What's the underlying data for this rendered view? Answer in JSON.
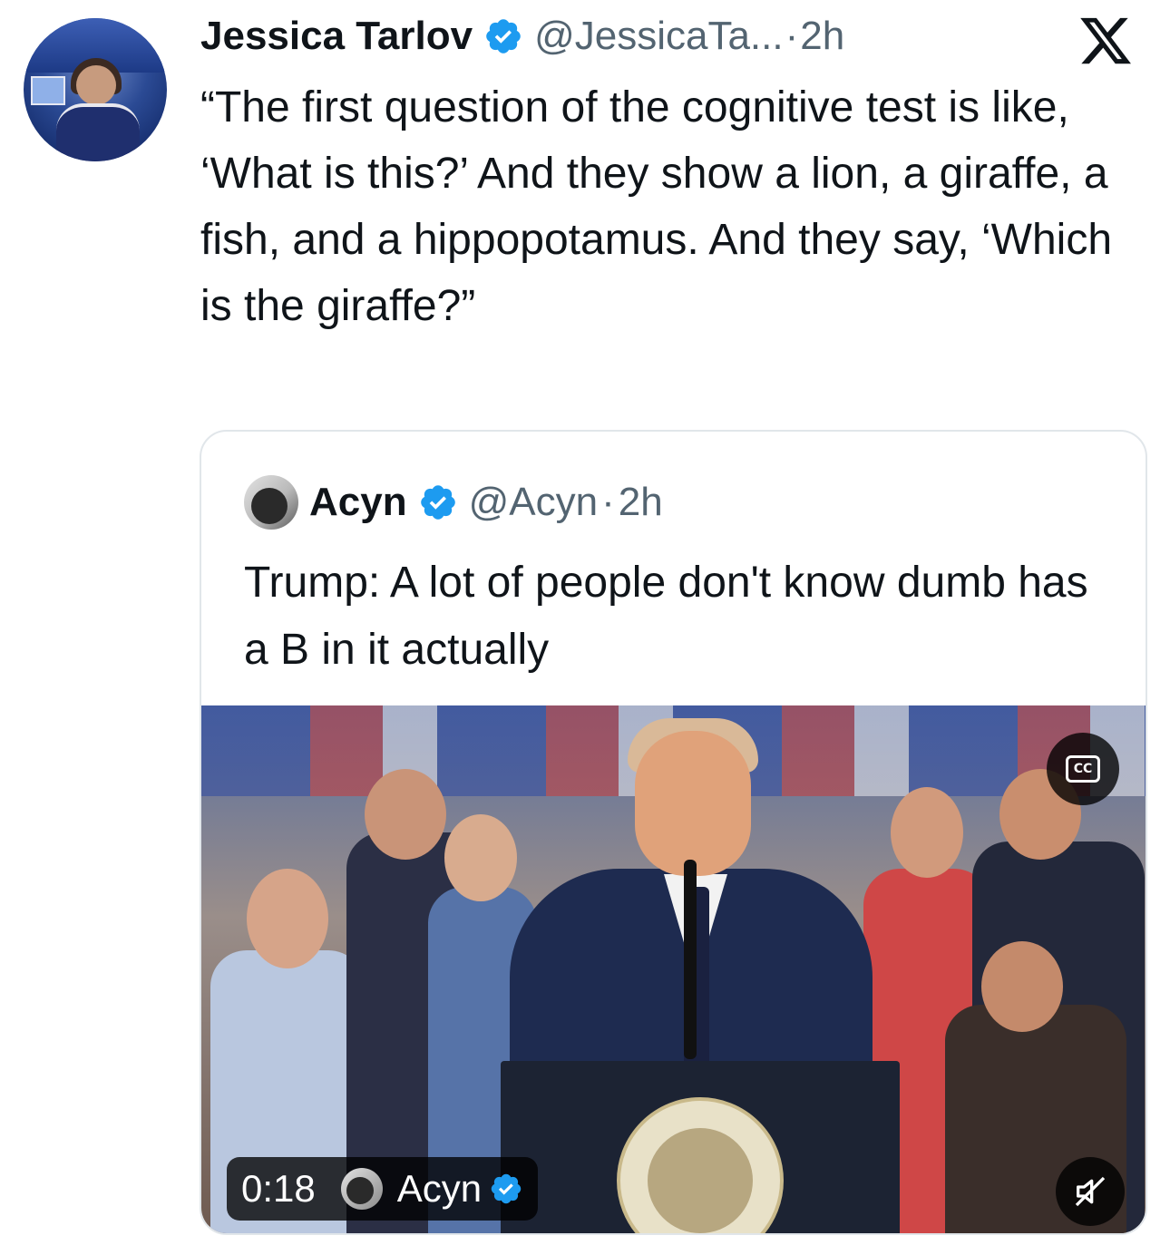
{
  "tweet": {
    "author_name": "Jessica Tarlov",
    "author_handle": "@JessicaTa...",
    "separator": "·",
    "time": "2h",
    "text": "“The first question of the cognitive test is like, ‘What is this?’ And they show a lion, a giraffe, a fish, and a hippopotamus. And they say, ‘Which is the giraffe?”"
  },
  "quote": {
    "author_name": "Acyn",
    "author_handle": "@Acyn",
    "separator": "·",
    "time": "2h",
    "text": "Trump: A lot of people don't know dumb has a B in it actually"
  },
  "video": {
    "duration": "0:18",
    "channel_name": "Acyn",
    "cc_label": "CC",
    "muted": true
  },
  "colors": {
    "verified": "#1d9bf0",
    "handle": "#536471",
    "text": "#0f1419",
    "border": "#e1e6ea"
  },
  "icons": {
    "verified": "verified-badge-icon",
    "x_logo": "x-logo-icon",
    "captions": "closed-captions-icon",
    "mute": "muted-speaker-icon"
  }
}
